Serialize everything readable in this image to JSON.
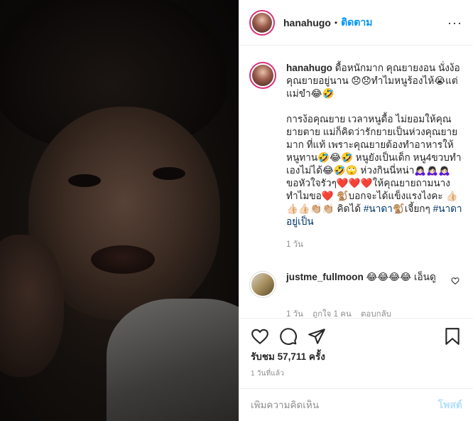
{
  "post": {
    "username": "hanahugo",
    "follow_label": "ติดตาม",
    "more_label": "···"
  },
  "caption": {
    "username": "hanahugo",
    "text": "ดื้อหนักมาก คุณยายงอน นั่งง้อคุณยายอยู่นาน 😞😞ทำไมหนูร้องไห้😭แต่แม่ขำ😂🤣\n\nการง้อคุณยาย เวลาหนูดื้อ ไม่ยอมให้คุณยายตาย แม่ก็คิดว่ารักยายเป็นห่วงคุณยายมาก ที่แท้ เพราะคุณยายต้องทำอาหารให้หนูทาน🤣😂🤣 หนูยังเป็นเด็ก หนู4ขวบทำเองไม่ได้😂🤣🙄 ห่วงกินนี่หน่า🙇🏻‍♀️🙇🏻‍♀️🙇🏻‍♀️ ขอหัวใจรัวๆ❤️❤️❤️ให้คุณยายถามนางทำไมขอ❤️ 🐒บอกจะได้แข็งแรงไงคะ 👍🏻👍🏻👍🏻👏🏼👏🏼 คิดได้ ",
    "hashtag1": "#นาดา",
    "mid": "🐒เจี้ยกๆ ",
    "hashtag2": "#นาดาอยู่เป็น",
    "time": "1 วัน"
  },
  "reply": {
    "username": "justme_fullmoon",
    "text": " 😂😂😂😂 เอ็นดู",
    "time": "1 วัน",
    "likes": "ถูกใจ 1 คน",
    "reply_label": "ตอบกลับ"
  },
  "likes_text": "รับชม 57,711 ครั้ง",
  "posted_time": "1 วันที่แล้ว",
  "comment_box": {
    "placeholder": "เพิ่มความคิดเห็น",
    "post_label": "โพสต์"
  },
  "colors": {
    "accent": "#0095f6",
    "post_disabled": "#b2dffc",
    "story_ring": "#d8317a"
  },
  "icons": [
    "heart-icon",
    "comment-icon",
    "share-icon",
    "bookmark-icon",
    "more-icon"
  ]
}
